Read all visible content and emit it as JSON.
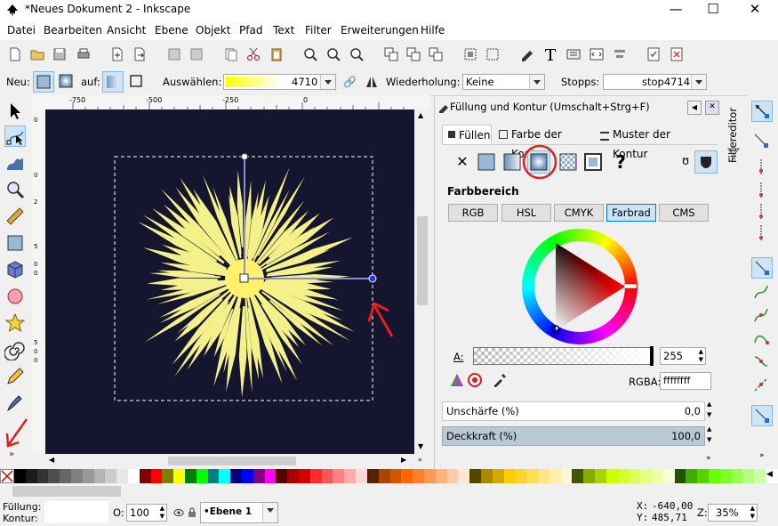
{
  "window": {
    "title": "*Neues Dokument 2 - Inkscape",
    "minimize": "—",
    "maximize": "☐",
    "close": "✕"
  },
  "menu": [
    "Datei",
    "Bearbeiten",
    "Ansicht",
    "Ebene",
    "Objekt",
    "Pfad",
    "Text",
    "Filter",
    "Erweiterungen",
    "Hilfe"
  ],
  "controls": {
    "new_label": "Neu:",
    "on_label": "auf:",
    "select_label": "Auswählen:",
    "gradient_id": "4710",
    "repeat_label": "Wiederholung:",
    "repeat_value": "Keine",
    "stops_label": "Stopps:",
    "stop_value": "stop4714"
  },
  "rulers": {
    "top": [
      "-750",
      "-500",
      "-250",
      "0"
    ],
    "left": [
      "0",
      "0",
      "2",
      "5",
      "0",
      "0",
      "5",
      "0",
      "0"
    ]
  },
  "panel": {
    "title": "Füllung und Kontur (Umschalt+Strg+F)",
    "tabs": [
      "Füllen",
      "Farbe der Kontur",
      "Muster der Kontur"
    ],
    "active_tab": "Füllen",
    "paint_unknown": "?",
    "section_label": "Farbbereich",
    "color_modes": [
      "RGB",
      "HSL",
      "CMYK",
      "Farbrad",
      "CMS"
    ],
    "active_mode": "Farbrad",
    "alpha_label": "A:",
    "alpha_value": "255",
    "rgba_label": "RGBA:",
    "rgba_value": "ffffffff",
    "blur_label": "Unschärfe (%)",
    "blur_value": "0,0",
    "opacity_label": "Deckkraft (%)",
    "opacity_value": "100,0",
    "opacity_level": 1.0
  },
  "side_panel": {
    "filter_editor": "Filtereditor"
  },
  "palette_colors": [
    "#000000",
    "#1a1a1a",
    "#333333",
    "#4d4d4d",
    "#666666",
    "#808080",
    "#999999",
    "#b3b3b3",
    "#cccccc",
    "#e6e6e6",
    "#ffffff",
    "#800000",
    "#ff0000",
    "#808000",
    "#ffff00",
    "#008000",
    "#00ff00",
    "#008080",
    "#00ffff",
    "#000080",
    "#0000ff",
    "#800080",
    "#ff00ff",
    "#550000",
    "#aa0000",
    "#d40000",
    "#ff2a2a",
    "#ff5555",
    "#ff8080",
    "#ffaaaa",
    "#ffd5d5",
    "#552200",
    "#aa4400",
    "#d45500",
    "#ff6600",
    "#ff7f2a",
    "#ff9955",
    "#ffb380",
    "#ffccaa",
    "#ffe6d5",
    "#554400",
    "#aa8800",
    "#d4aa00",
    "#ffcc00",
    "#ffd42a",
    "#ffdd55",
    "#ffe680",
    "#ffeeaa",
    "#fff6d5",
    "#445500",
    "#88aa00",
    "#aad400",
    "#ccff00",
    "#d4ff2a",
    "#ddff55",
    "#e5ff80",
    "#eeffaa",
    "#f6ffd5",
    "#225500",
    "#44aa00",
    "#55d400",
    "#66ff00",
    "#7fff2a",
    "#99ff55",
    "#b3ff80",
    "#ccffaa"
  ],
  "status": {
    "fill_label": "Füllung:",
    "stroke_label": "Kontur:",
    "opacity_label": "O:",
    "opacity_value": "100",
    "layer_value": "•Ebene 1",
    "x_label": "X:",
    "x_value": "-640,00",
    "y_label": "Y:",
    "y_value": "485,71",
    "zoom_label": "Z:",
    "zoom_value": "35%"
  },
  "colors": {
    "canvas": "#15152f",
    "burst": "#f4f08a",
    "accent_blue": "#0078d7",
    "annotation_red": "#e41e1e"
  }
}
